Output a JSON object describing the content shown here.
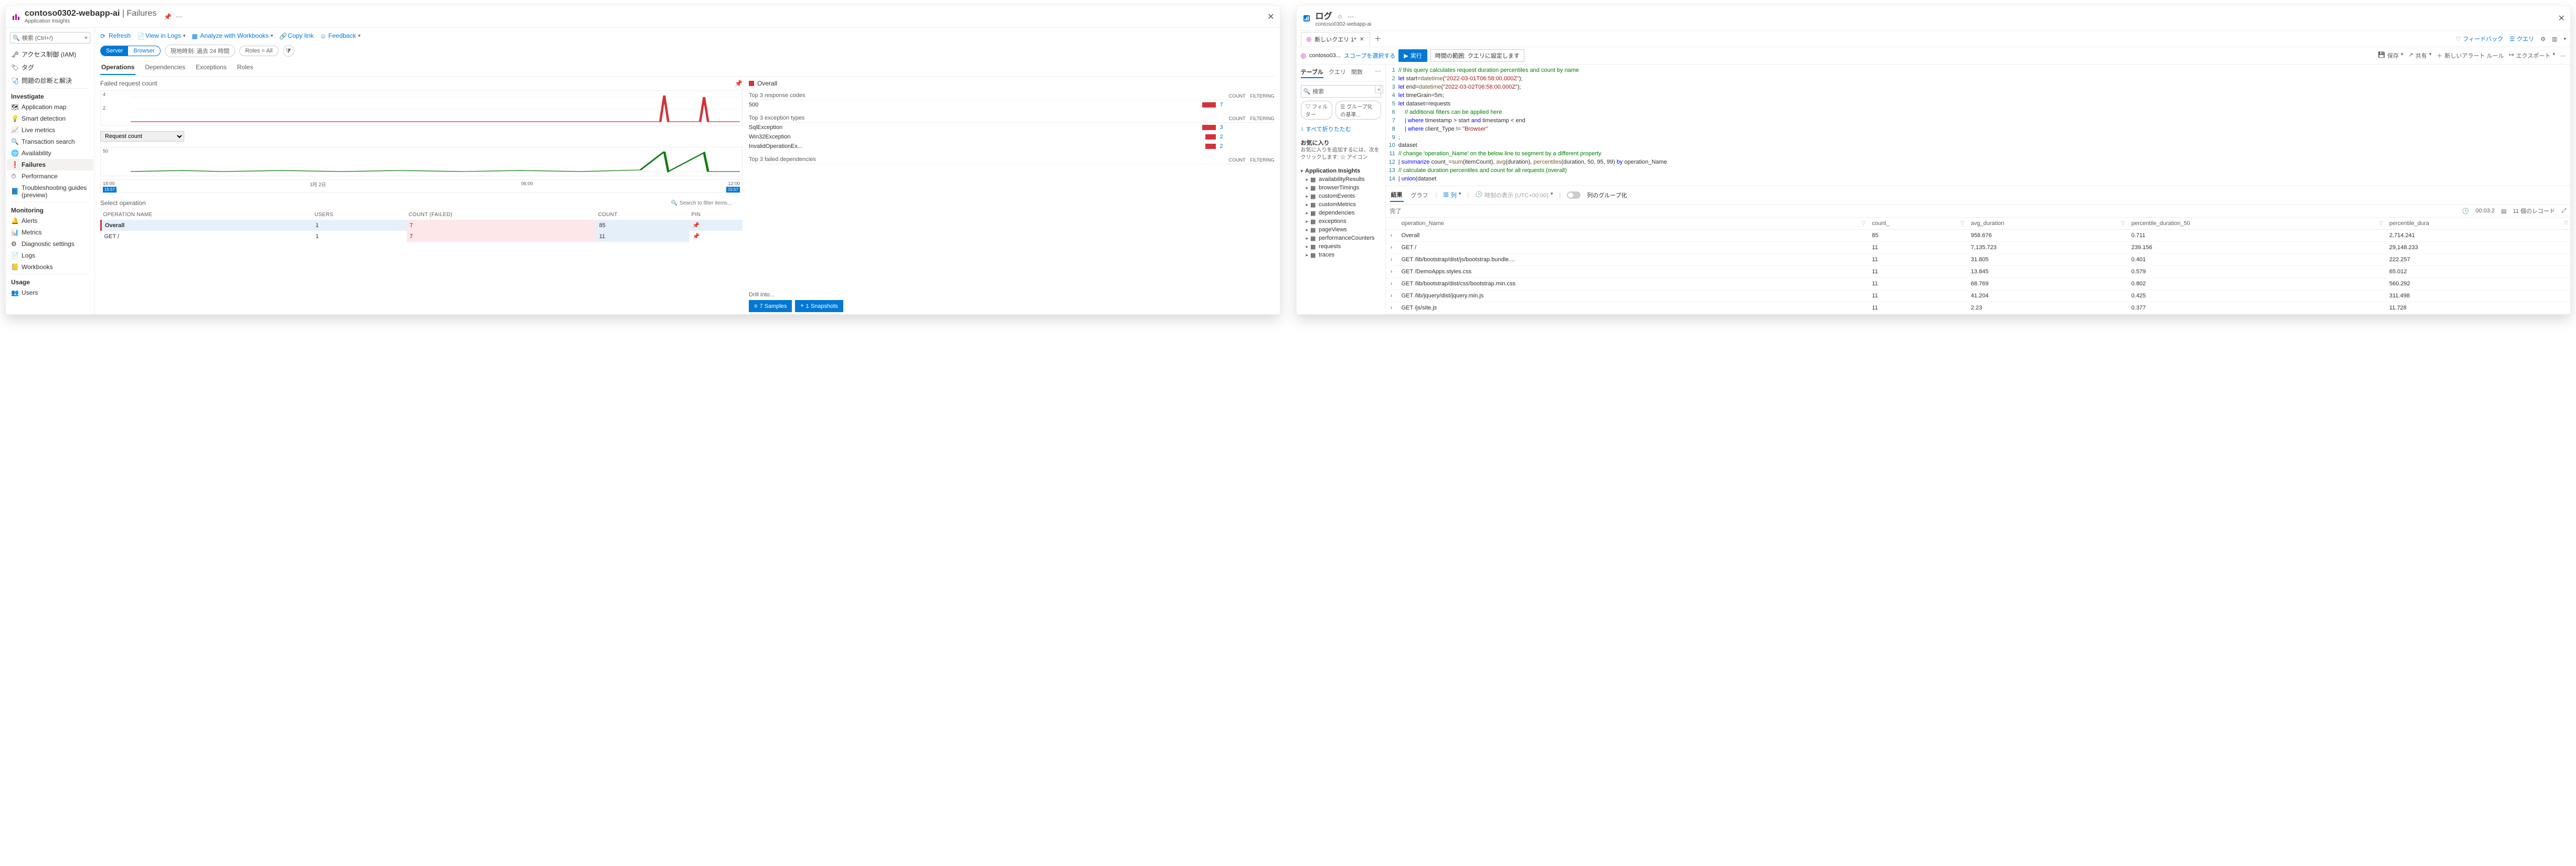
{
  "left": {
    "header": {
      "title": "contoso0302-webapp-ai",
      "section": " | Failures",
      "subtitle": "Application Insights"
    },
    "search_placeholder": "検索 (Ctrl+/)",
    "sidebar": {
      "items_top": [
        {
          "icon": "key",
          "label": "アクセス制御 (IAM)"
        },
        {
          "icon": "tag",
          "label": "タグ"
        },
        {
          "icon": "diagnose",
          "label": "問題の診断と解決"
        }
      ],
      "groups": [
        {
          "label": "Investigate",
          "items": [
            {
              "icon": "appmap",
              "label": "Application map"
            },
            {
              "icon": "smart",
              "label": "Smart detection"
            },
            {
              "icon": "live",
              "label": "Live metrics"
            },
            {
              "icon": "search",
              "label": "Transaction search"
            },
            {
              "icon": "avail",
              "label": "Availability"
            },
            {
              "icon": "fail",
              "label": "Failures",
              "active": true
            },
            {
              "icon": "perf",
              "label": "Performance"
            },
            {
              "icon": "guide",
              "label": "Troubleshooting guides (preview)"
            }
          ]
        },
        {
          "label": "Monitoring",
          "items": [
            {
              "icon": "alerts",
              "label": "Alerts"
            },
            {
              "icon": "metrics",
              "label": "Metrics"
            },
            {
              "icon": "diag",
              "label": "Diagnostic settings"
            },
            {
              "icon": "logs",
              "label": "Logs"
            },
            {
              "icon": "wb",
              "label": "Workbooks"
            }
          ]
        },
        {
          "label": "Usage",
          "items": [
            {
              "icon": "users",
              "label": "Users"
            }
          ]
        }
      ]
    },
    "toolbar": {
      "refresh": "Refresh",
      "view_logs": "View in Logs",
      "analyze": "Analyze with Workbooks",
      "copy": "Copy link",
      "feedback": "Feedback"
    },
    "pills": {
      "server": "Server",
      "browser": "Browser",
      "time": "現地時刻: 過去 24 時間",
      "roles": "Roles = All"
    },
    "subtabs": [
      "Operations",
      "Dependencies",
      "Exceptions",
      "Roles"
    ],
    "charts": {
      "title": "Failed request count",
      "request_count_select": "Request count",
      "chart_data": {
        "top": {
          "type": "line",
          "ylim": [
            0,
            4
          ],
          "yticks": [
            2,
            4
          ],
          "color": "#d13438",
          "xticks": [
            "18:00",
            "3月 2日",
            "06:00",
            "12:00"
          ],
          "note": "mostly zero with two tall spikes near end"
        },
        "bottom": {
          "type": "line",
          "ylim": [
            0,
            50
          ],
          "yticks": [
            50
          ],
          "color": "#107c10",
          "xticks": [
            "18:00",
            "3月 2日",
            "06:00",
            "12:00"
          ],
          "note": "periodic small bumps with spikes at end",
          "brush_start": "15:57",
          "brush_end": "15:57"
        }
      }
    },
    "select_op": {
      "title": "Select operation",
      "search_placeholder": "Search to filter items...",
      "columns": [
        "OPERATION NAME",
        "USERS",
        "COUNT (FAILED)",
        "COUNT",
        "PIN"
      ],
      "rows": [
        {
          "name": "Overall",
          "users": "1",
          "failed": "7",
          "count": "85",
          "overall": true
        },
        {
          "name": "GET /",
          "users": "1",
          "failed": "7",
          "count": "11"
        }
      ]
    },
    "right_cards": {
      "overall_label": "Overall",
      "response": {
        "title": "Top 3 response codes",
        "cols": [
          "COUNT",
          "FILTERING"
        ],
        "rows": [
          {
            "label": "500",
            "bar": 26,
            "val": "7"
          }
        ]
      },
      "exceptions": {
        "title": "Top 3 exception types",
        "cols": [
          "COUNT",
          "FILTERING"
        ],
        "rows": [
          {
            "label": "SqlException",
            "bar": 26,
            "val": "3"
          },
          {
            "label": "Win32Exception",
            "bar": 20,
            "val": "2"
          },
          {
            "label": "InvalidOperationEx...",
            "bar": 20,
            "val": "2"
          }
        ]
      },
      "deps": {
        "title": "Top 3 failed dependencies",
        "cols": [
          "COUNT",
          "FILTERING"
        ],
        "rows": []
      },
      "drill": {
        "label": "Drill into...",
        "samples": "7 Samples",
        "snapshots": "1 Snapshots"
      }
    }
  },
  "right": {
    "header": {
      "title": "ログ",
      "subtitle": "contoso0302-webapp-ai"
    },
    "tab": {
      "label": "新しいクエリ 1*"
    },
    "top_toolbar": {
      "feedback": "フィードバック",
      "queries": "クエリ"
    },
    "query_bar": {
      "scope_value": "contoso03...",
      "scope_link": "スコープを選択する",
      "run": "実行",
      "time_label": "時間の範囲:",
      "time_value": "クエリに設定します",
      "save": "保存",
      "share": "共有",
      "new_alert": "新しいアラート ルール",
      "export": "エクスポート"
    },
    "sidebar": {
      "tabs": [
        "テーブル",
        "クエリ",
        "関数"
      ],
      "search_placeholder": "検索",
      "filter": "フィルター",
      "group": "グループ化の基準...",
      "collapse": "すべて折りたたむ",
      "fav_title": "お気に入り",
      "fav_hint": "お気に入りを追加するには、次をクリックします: ☆ アイコン",
      "tree_root": "Application Insights",
      "tree": [
        "availabilityResults",
        "browserTimings",
        "customEvents",
        "customMetrics",
        "dependencies",
        "exceptions",
        "pageViews",
        "performanceCounters",
        "requests",
        "traces"
      ]
    },
    "code_lines": [
      {
        "n": 1,
        "html": "<span class='cm-comment'>// this query calculates request duration percentiles and count by name</span>"
      },
      {
        "n": 2,
        "html": "<span class='cm-kw'>let</span> start=<span class='cm-fn'>datetime</span>(<span class='cm-str'>\"2022-03-01T06:58:00.000Z\"</span>);"
      },
      {
        "n": 3,
        "html": "<span class='cm-kw'>let</span> end=<span class='cm-fn'>datetime</span>(<span class='cm-str'>\"2022-03-02T06:58:00.000Z\"</span>);"
      },
      {
        "n": 4,
        "html": "<span class='cm-kw'>let</span> timeGrain=5m;"
      },
      {
        "n": 5,
        "html": "<span class='cm-kw'>let</span> dataset=requests"
      },
      {
        "n": 6,
        "html": "    <span class='cm-comment'>// additional filters can be applied here</span>"
      },
      {
        "n": 7,
        "html": "    | <span class='cm-kw'>where</span> timestamp &gt; start <span class='cm-kw'>and</span> timestamp &lt; end"
      },
      {
        "n": 8,
        "html": "    | <span class='cm-kw'>where</span> client_Type != <span class='cm-str'>\"Browser\"</span>"
      },
      {
        "n": 9,
        "html": ";"
      },
      {
        "n": 10,
        "html": "dataset"
      },
      {
        "n": 11,
        "html": "<span class='cm-comment'>// change 'operation_Name' on the below line to segment by a different property</span>"
      },
      {
        "n": 12,
        "html": "| <span class='cm-kw'>summarize</span> count_=<span class='cm-fn'>sum</span>(itemCount), <span class='cm-fn'>avg</span>(duration), <span class='cm-fn'>percentiles</span>(duration, 50, 95, 99) <span class='cm-kw'>by</span> operation_Name"
      },
      {
        "n": 13,
        "html": "<span class='cm-comment'>// calculate duration percentiles and count for all requests (overall)</span>"
      },
      {
        "n": 14,
        "html": "| <span class='cm-kw'>union</span>(dataset"
      }
    ],
    "results": {
      "tabs": [
        "結果",
        "グラフ"
      ],
      "columns_btn": "列",
      "time_display": "時刻の表示 (UTC+00:00)",
      "group_cols": "列のグループ化",
      "status": "完了",
      "elapsed": "00:03.2",
      "record_count": "11 個のレコード",
      "headers": [
        "operation_Name",
        "count_",
        "avg_duration",
        "percentile_duration_50",
        "percentile_dura"
      ],
      "rows": [
        {
          "c": [
            "Overall",
            "85",
            "958.676",
            "0.711",
            "2,714.241"
          ]
        },
        {
          "c": [
            "GET /",
            "11",
            "7,135.723",
            "239.156",
            "29,148.233"
          ]
        },
        {
          "c": [
            "GET /lib/bootstrap/dist/js/bootstrap.bundle....",
            "11",
            "31.805",
            "0.401",
            "222.257"
          ]
        },
        {
          "c": [
            "GET /DemoApps.styles.css",
            "11",
            "13.845",
            "0.579",
            "65.012"
          ]
        },
        {
          "c": [
            "GET /lib/bootstrap/dist/css/bootstrap.min.css",
            "11",
            "68.769",
            "0.802",
            "560.292"
          ]
        },
        {
          "c": [
            "GET /lib/jquery/dist/jquery.min.js",
            "11",
            "41.204",
            "0.425",
            "311.498"
          ]
        },
        {
          "c": [
            "GET /js/site.js",
            "11",
            "2.23",
            "0.377",
            "11.728"
          ]
        }
      ]
    }
  },
  "chart_data": [
    {
      "type": "line",
      "title": "Failed request count",
      "ylim": [
        0,
        4
      ],
      "xticks": [
        "18:00",
        "3月 2日",
        "06:00",
        "12:00"
      ],
      "series": [
        {
          "name": "failed",
          "values_note": "baseline 0 with two spikes ~4 near 15:57"
        }
      ]
    },
    {
      "type": "line",
      "title": "Request count",
      "ylim": [
        0,
        50
      ],
      "xticks": [
        "18:00",
        "3月 2日",
        "06:00",
        "12:00"
      ],
      "series": [
        {
          "name": "requests",
          "values_note": "small periodic bumps then spikes near 15:57"
        }
      ]
    }
  ]
}
